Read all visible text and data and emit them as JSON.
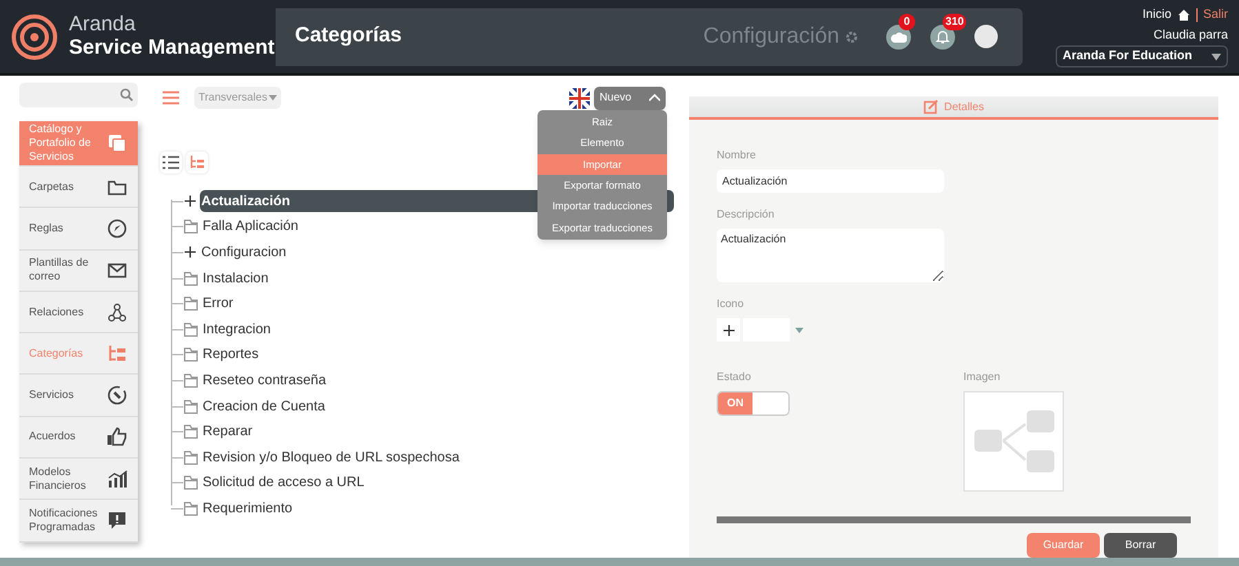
{
  "header": {
    "logo": {
      "line1": "Aranda",
      "line2": "Service Management"
    },
    "breadcrumb": "Categorías",
    "section": "Configuración",
    "notifications": [
      {
        "kind": "cloud",
        "count": "0"
      },
      {
        "kind": "bell",
        "count": "310"
      }
    ],
    "user": {
      "home_link": "Inicio",
      "logout_link": "Salir",
      "name": "Claudia parra",
      "organization": "Aranda For Education"
    }
  },
  "sidebar": {
    "items": [
      {
        "label": "Catálogo y Portafolio de Servicios",
        "kind": "header",
        "selected": false
      },
      {
        "label": "Carpetas",
        "kind": "item",
        "selected": false
      },
      {
        "label": "Reglas",
        "kind": "item",
        "selected": false
      },
      {
        "label": "Plantillas de correo",
        "kind": "item",
        "selected": false
      },
      {
        "label": "Relaciones",
        "kind": "item",
        "selected": false
      },
      {
        "label": "Categorías",
        "kind": "item",
        "selected": true
      },
      {
        "label": "Servicios",
        "kind": "item",
        "selected": false
      },
      {
        "label": "Acuerdos",
        "kind": "item",
        "selected": false
      },
      {
        "label": "Modelos Financieros",
        "kind": "item",
        "selected": false
      },
      {
        "label": "Notificaciones Programadas",
        "kind": "item",
        "selected": false
      }
    ]
  },
  "toolbar": {
    "filter": "Transversales",
    "new_button": {
      "label": "Nuevo",
      "expanded": true,
      "menu": [
        {
          "label": "Raiz",
          "selected": false
        },
        {
          "label": "Elemento",
          "selected": false
        },
        {
          "label": "Importar",
          "selected": true
        },
        {
          "label": "Exportar formato",
          "selected": false
        },
        {
          "label": "Importar traducciones",
          "selected": false
        },
        {
          "label": "Exportar traducciones",
          "selected": false
        }
      ]
    },
    "views": [
      {
        "kind": "list",
        "selected": false
      },
      {
        "kind": "tree",
        "selected": true
      }
    ]
  },
  "tree": [
    {
      "label": "Actualización",
      "kind": "expandable",
      "selected": true
    },
    {
      "label": "Falla Aplicación",
      "kind": "leaf",
      "selected": false
    },
    {
      "label": "Configuracion",
      "kind": "expandable",
      "selected": false
    },
    {
      "label": "Instalacion",
      "kind": "leaf",
      "selected": false
    },
    {
      "label": "Error",
      "kind": "leaf",
      "selected": false
    },
    {
      "label": "Integracion",
      "kind": "leaf",
      "selected": false
    },
    {
      "label": "Reportes",
      "kind": "leaf",
      "selected": false
    },
    {
      "label": "Reseteo contraseña",
      "kind": "leaf",
      "selected": false
    },
    {
      "label": "Creacion de Cuenta",
      "kind": "leaf",
      "selected": false
    },
    {
      "label": "Reparar",
      "kind": "leaf",
      "selected": false
    },
    {
      "label": "Revision y/o Bloqueo de URL sospechosa",
      "kind": "leaf",
      "selected": false
    },
    {
      "label": "Solicitud de acceso a URL",
      "kind": "leaf",
      "selected": false
    },
    {
      "label": "Requerimiento",
      "kind": "leaf",
      "selected": false
    }
  ],
  "details": {
    "tab": "Detalles",
    "name": {
      "label": "Nombre",
      "value": "Actualización"
    },
    "description": {
      "label": "Descripción",
      "value": "Actualización"
    },
    "icon_field": {
      "label": "Icono"
    },
    "status": {
      "label": "Estado",
      "toggle_label": "ON",
      "on": true
    },
    "image": {
      "label": "Imagen"
    },
    "buttons": [
      {
        "label": "Guardar",
        "kind": "primary"
      },
      {
        "label": "Borrar",
        "kind": "secondary"
      }
    ]
  }
}
